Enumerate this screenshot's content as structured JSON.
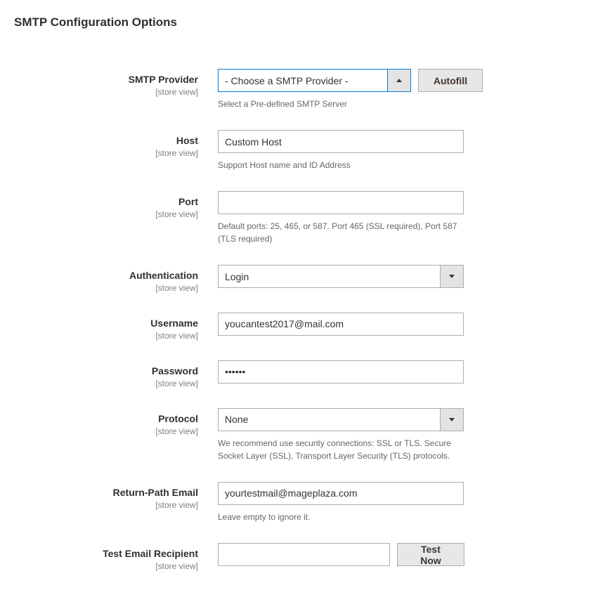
{
  "section_title": "SMTP Configuration Options",
  "scope_label": "[store view]",
  "provider": {
    "label": "SMTP Provider",
    "value": "- Choose a SMTP Provider -",
    "note": "Select a Pre-defined SMTP Server",
    "autofill_label": "Autofill"
  },
  "host": {
    "label": "Host",
    "value": "Custom Host",
    "note": "Support Host name and ID Address"
  },
  "port": {
    "label": "Port",
    "value": "",
    "note": "Default ports: 25, 465, or 587. Port 465 (SSL required), Port 587 (TLS required)"
  },
  "auth": {
    "label": "Authentication",
    "value": "Login"
  },
  "username": {
    "label": "Username",
    "value": "youcantest2017@mail.com"
  },
  "password": {
    "label": "Password",
    "value": "••••••"
  },
  "protocol": {
    "label": "Protocol",
    "value": "None",
    "note": "We recommend use security connections: SSL or TLS. Secure Socket Layer (SSL), Transport Layer Security (TLS) protocols."
  },
  "return_path": {
    "label": "Return-Path Email",
    "value": "yourtestmail@mageplaza.com",
    "note": "Leave empty to ignore it."
  },
  "test": {
    "label": "Test Email Recipient",
    "value": "",
    "button_label": "Test Now"
  }
}
